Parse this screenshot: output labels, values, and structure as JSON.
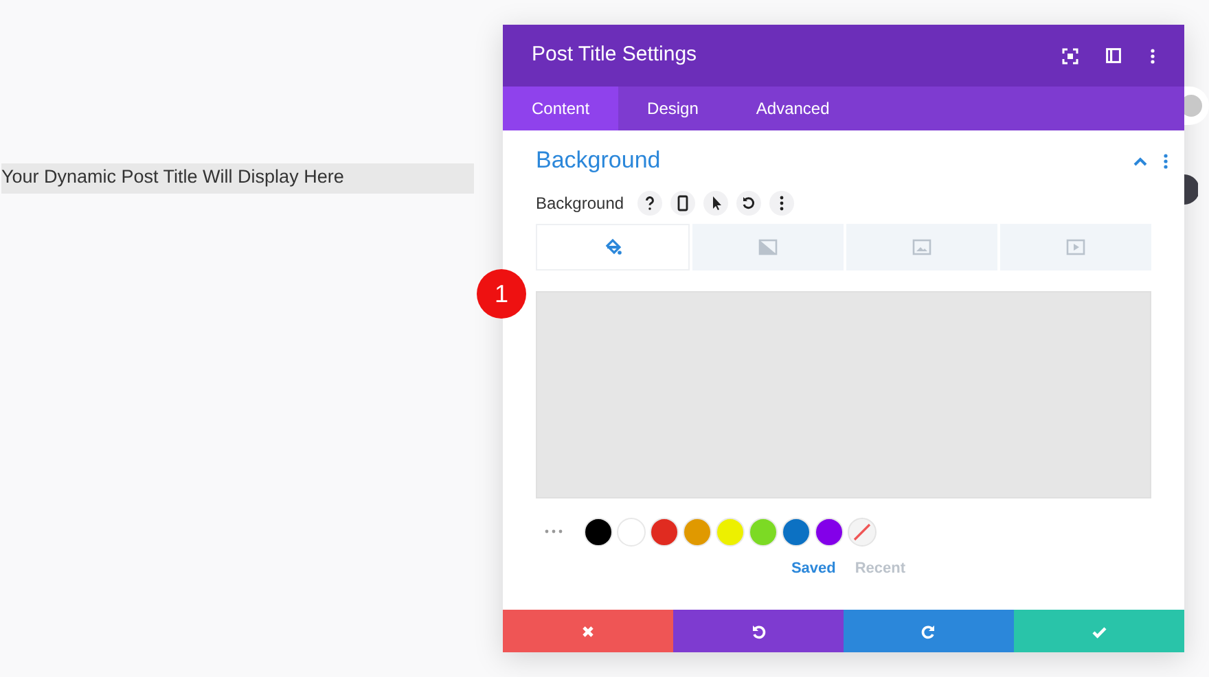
{
  "page": {
    "post_title": "Your Dynamic Post Title Will Display Here"
  },
  "step_badge": "1",
  "modal": {
    "title": "Post Title Settings",
    "tabs": [
      {
        "label": "Content",
        "selected": true
      },
      {
        "label": "Design",
        "selected": false
      },
      {
        "label": "Advanced",
        "selected": false
      }
    ],
    "section": {
      "title": "Background",
      "expanded": true,
      "field_label": "Background",
      "bg_types": [
        {
          "kind": "color",
          "selected": true
        },
        {
          "kind": "gradient",
          "selected": false
        },
        {
          "kind": "image",
          "selected": false
        },
        {
          "kind": "video",
          "selected": false
        }
      ],
      "swatches": [
        {
          "color": "#000000"
        },
        {
          "color": "#ffffff"
        },
        {
          "color": "#e02b20"
        },
        {
          "color": "#e09900"
        },
        {
          "color": "#edf000"
        },
        {
          "color": "#7cda24"
        },
        {
          "color": "#0c71c3"
        },
        {
          "color": "#8300e9"
        }
      ],
      "palette_tabs": [
        {
          "label": "Saved",
          "selected": true
        },
        {
          "label": "Recent",
          "selected": false
        }
      ]
    },
    "footer": [
      {
        "kind": "cancel"
      },
      {
        "kind": "undo"
      },
      {
        "kind": "redo"
      },
      {
        "kind": "save"
      }
    ]
  }
}
